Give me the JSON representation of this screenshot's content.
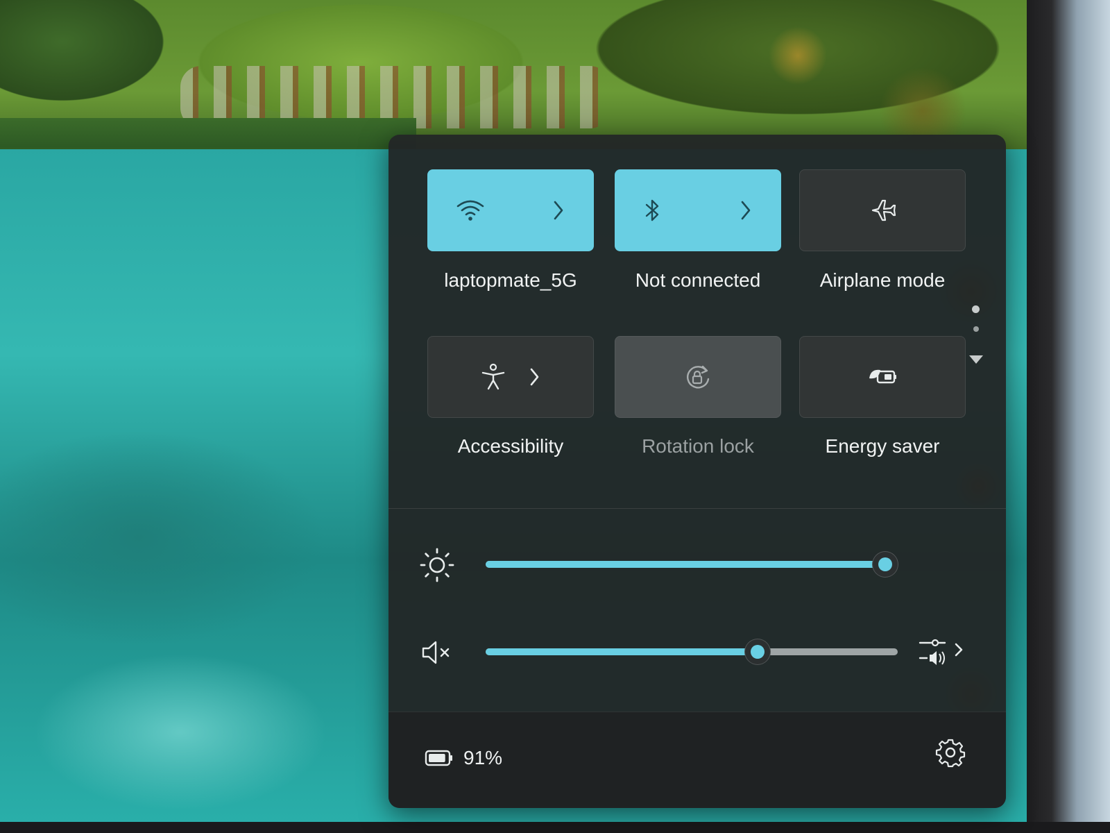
{
  "quick_settings": {
    "tiles": [
      {
        "id": "wifi",
        "label": "laptopmate_5G",
        "state": "on",
        "icon": "wifi-icon",
        "has_chevron": true
      },
      {
        "id": "bluetooth",
        "label": "Not connected",
        "state": "on",
        "icon": "bluetooth-icon",
        "has_chevron": true
      },
      {
        "id": "airplane",
        "label": "Airplane mode",
        "state": "off",
        "icon": "airplane-icon",
        "has_chevron": false
      },
      {
        "id": "accessibility",
        "label": "Accessibility",
        "state": "off",
        "icon": "accessibility-icon",
        "has_chevron": true
      },
      {
        "id": "rotation",
        "label": "Rotation lock",
        "state": "disabled",
        "icon": "rotation-lock-icon",
        "has_chevron": false
      },
      {
        "id": "energy",
        "label": "Energy saver",
        "state": "off",
        "icon": "energy-saver-icon",
        "has_chevron": false
      }
    ],
    "pages": {
      "current": 1,
      "total": 2
    },
    "brightness": {
      "icon": "brightness-icon",
      "level": 0.97
    },
    "volume": {
      "icon": "volume-muted-icon",
      "level": 0.66,
      "muted": true,
      "mixer_icon": "audio-mixer-icon"
    },
    "battery": {
      "icon": "battery-icon",
      "percent_text": "91%",
      "level": 0.91
    },
    "settings_icon": "gear-icon"
  },
  "colors": {
    "accent": "#69cfe3",
    "panel": "#222626",
    "tile_off": "#313535",
    "text": "#f1f3f3",
    "text_dim": "#9ba1a2"
  }
}
